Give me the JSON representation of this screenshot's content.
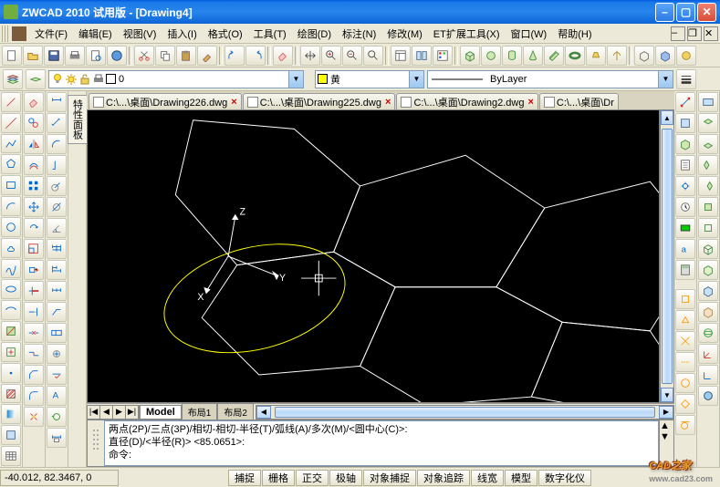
{
  "title": "ZWCAD 2010 试用版 - [Drawing4]",
  "menu": {
    "file": "文件(F)",
    "edit": "编辑(E)",
    "view": "视图(V)",
    "insert": "插入(I)",
    "format": "格式(O)",
    "tools": "工具(T)",
    "draw": "绘图(D)",
    "dimension": "标注(N)",
    "modify": "修改(M)",
    "ettools": "ET扩展工具(X)",
    "window": "窗口(W)",
    "help": "帮助(H)"
  },
  "layer": {
    "name": "0",
    "color_name": "黄",
    "linetype": "ByLayer"
  },
  "vtab": {
    "label": "特性面板"
  },
  "doctabs": [
    {
      "label": "C:\\...\\桌面\\Drawing226.dwg"
    },
    {
      "label": "C:\\...\\桌面\\Drawing225.dwg"
    },
    {
      "label": "C:\\...\\桌面\\Drawing2.dwg"
    },
    {
      "label": "C:\\...\\桌面\\Dr"
    }
  ],
  "axes": {
    "x": "X",
    "y": "Y",
    "z": "Z"
  },
  "tabs": {
    "model": "Model",
    "layout1": "布局1",
    "layout2": "布局2"
  },
  "cmd": {
    "line1": "两点(2P)/三点(3P)/相切-相切-半径(T)/弧线(A)/多次(M)/<圆中心(C)>:",
    "line2": "直径(D)/<半径(R)> <85.0651>:",
    "line3": "命令:"
  },
  "status": {
    "coords": "-40.012, 82.3467, 0",
    "snap": "捕捉",
    "grid": "栅格",
    "ortho": "正交",
    "polar": "极轴",
    "osnap": "对象捕捉",
    "otrack": "对象追踪",
    "lwt": "线宽",
    "model": "模型",
    "digitizer": "数字化仪"
  },
  "watermark": {
    "text": "CAD之家",
    "url": "www.cad23.com"
  }
}
